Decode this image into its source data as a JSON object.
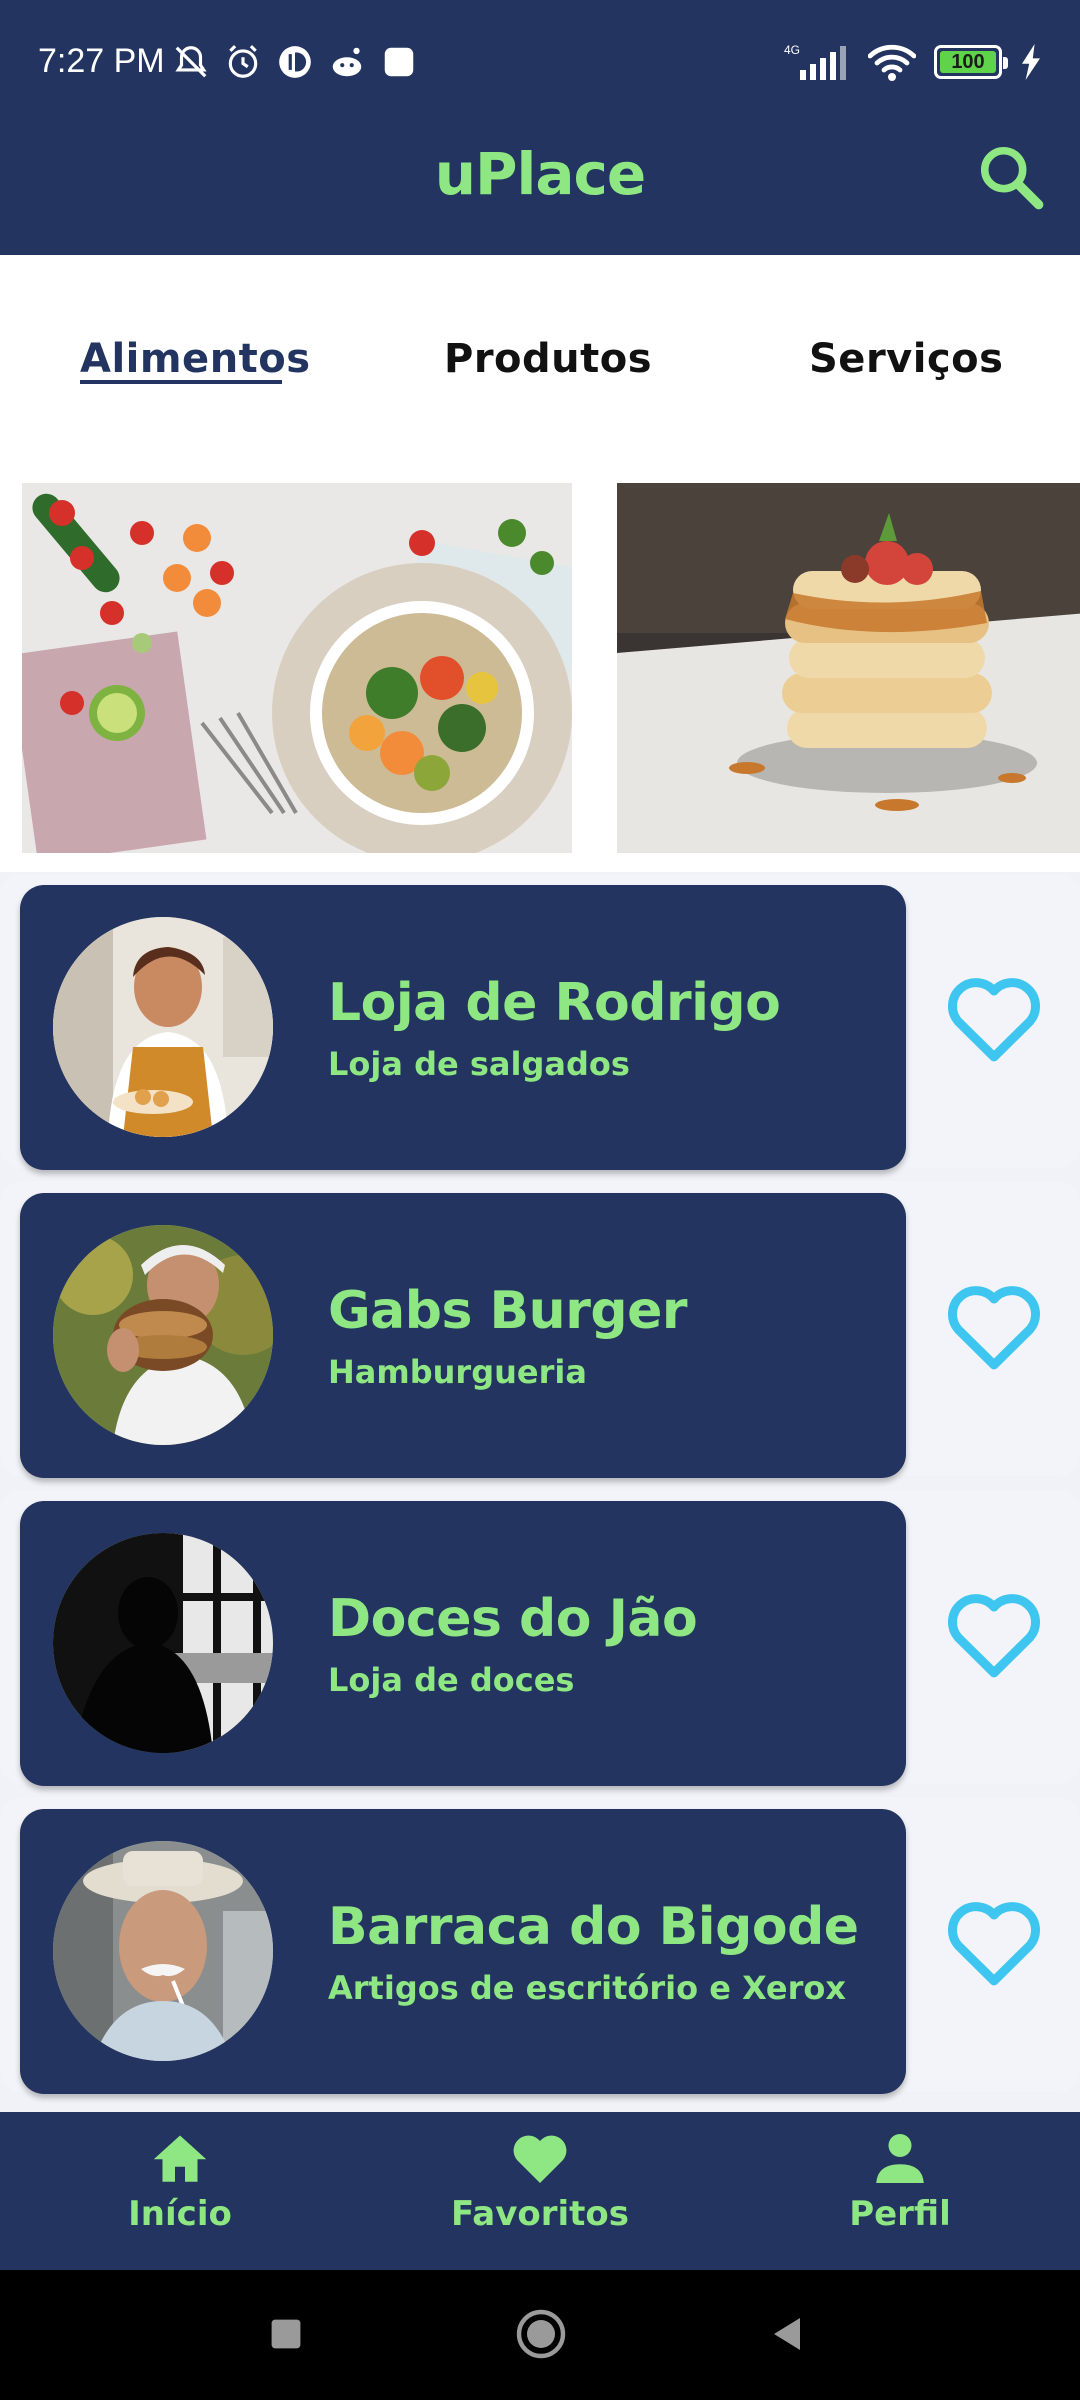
{
  "status_bar": {
    "time": "7:27 PM",
    "network": "4G",
    "battery": "100"
  },
  "app_bar": {
    "title": "uPlace",
    "search_icon": "search-icon"
  },
  "tabs": [
    {
      "label": "Alimentos",
      "active": true
    },
    {
      "label": "Produtos",
      "active": false
    },
    {
      "label": "Serviços",
      "active": false
    }
  ],
  "stores": [
    {
      "name": "Loja de Rodrigo",
      "category": "Loja de salgados"
    },
    {
      "name": "Gabs Burger",
      "category": "Hamburgueria"
    },
    {
      "name": "Doces do Jão",
      "category": "Loja de doces"
    },
    {
      "name": "Barraca do Bigode",
      "category": "Artigos de escritório e Xerox"
    }
  ],
  "bottom_nav": [
    {
      "label": "Início",
      "icon": "home-icon"
    },
    {
      "label": "Favoritos",
      "icon": "heart-icon"
    },
    {
      "label": "Perfil",
      "icon": "person-icon"
    }
  ],
  "colors": {
    "navy": "#22345f",
    "accent_green": "#8ee783",
    "heart_blue": "#3ec6f0",
    "list_bg": "#f1f2f8"
  }
}
